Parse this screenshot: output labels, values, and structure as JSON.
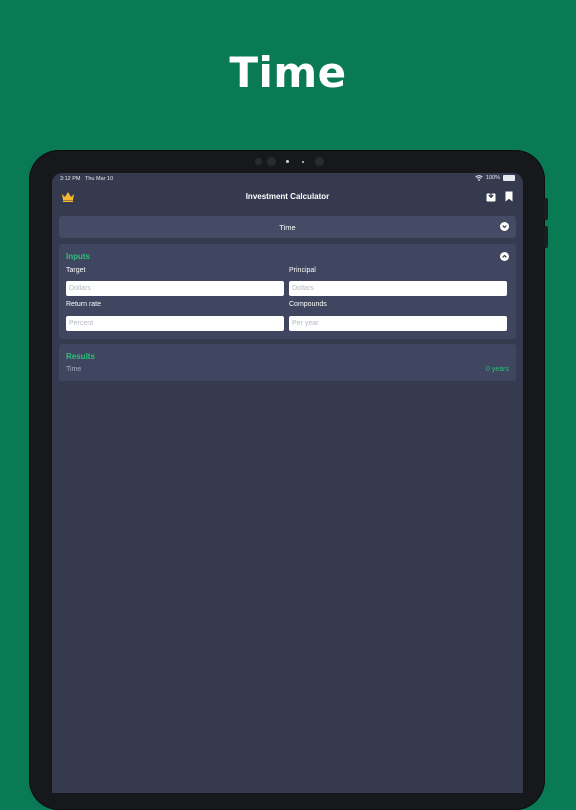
{
  "hero": {
    "title": "Time"
  },
  "status_bar": {
    "time": "3:12 PM",
    "date": "Thu Mar 10",
    "battery": "100%"
  },
  "nav": {
    "title": "Investment Calculator"
  },
  "mode_selector": {
    "label": "Time"
  },
  "inputs": {
    "title": "Inputs",
    "fields": {
      "target": {
        "label": "Target",
        "placeholder": "Dollars"
      },
      "principal": {
        "label": "Principal",
        "placeholder": "Dollars"
      },
      "return_rate": {
        "label": "Return rate",
        "placeholder": "Percent"
      },
      "compounds": {
        "label": "Compounds",
        "placeholder": "Per year"
      }
    }
  },
  "results": {
    "title": "Results",
    "row_label": "Time",
    "row_value": "0 years"
  },
  "colors": {
    "brand_bg": "#0a7a55",
    "screen_bg": "#363a4f",
    "card_bg": "#404560",
    "accent_green": "#2fc07a",
    "crown_gold": "#f5b82e"
  }
}
